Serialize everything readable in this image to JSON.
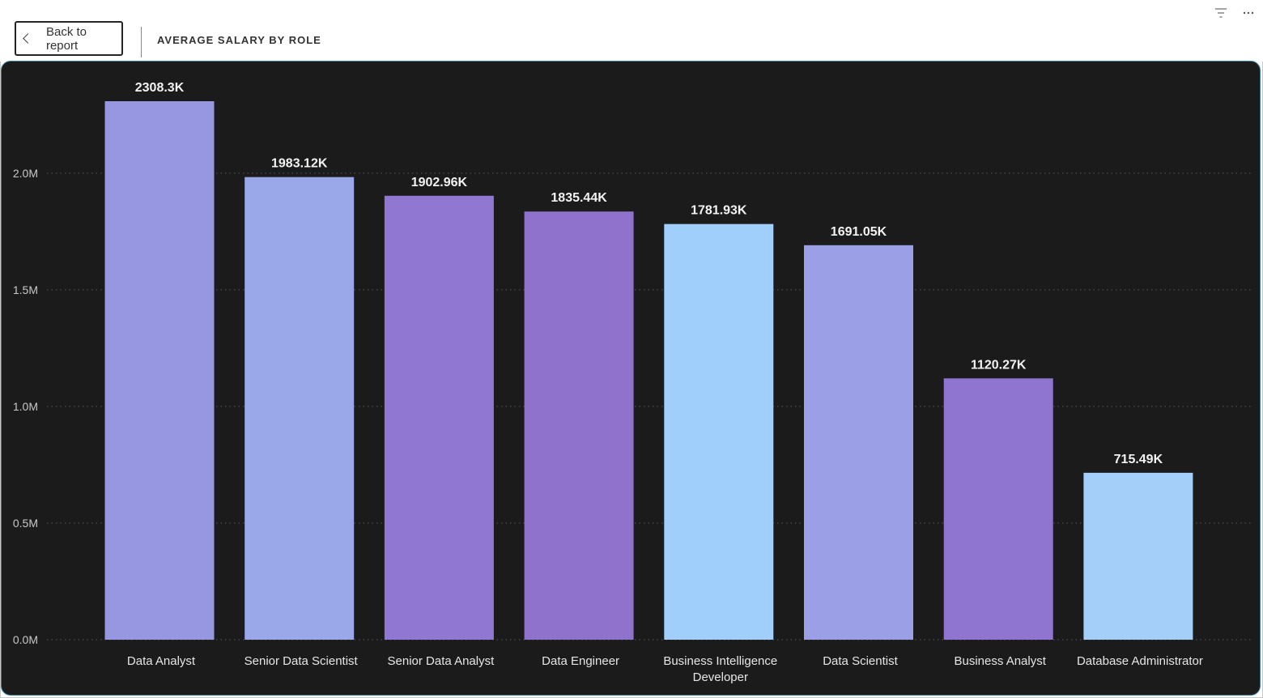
{
  "header": {
    "back_label": "Back to report",
    "title": "AVERAGE SALARY BY ROLE"
  },
  "icons": {
    "back": "chevron-left-icon",
    "filter": "filter-icon",
    "more": "more-options-icon"
  },
  "chart_data": {
    "type": "bar",
    "title": "AVERAGE SALARY BY ROLE",
    "xlabel": "",
    "ylabel": "",
    "categories": [
      [
        "Data Analyst"
      ],
      [
        "Senior Data Scientist"
      ],
      [
        "Senior Data Analyst"
      ],
      [
        "Data Engineer"
      ],
      [
        "Business Intelligence",
        "Developer"
      ],
      [
        "Data Scientist"
      ],
      [
        "Business Analyst"
      ],
      [
        "Database Administrator"
      ]
    ],
    "values": [
      2308300,
      1983120,
      1902960,
      1835440,
      1781930,
      1691050,
      1120270,
      715490
    ],
    "value_labels": [
      "2308.3K",
      "1983.12K",
      "1902.96K",
      "1835.44K",
      "1781.93K",
      "1691.05K",
      "1120.27K",
      "715.49K"
    ],
    "bar_colors": [
      "#9697e0",
      "#9aa8ea",
      "#9077d2",
      "#8f72cc",
      "#a1cffc",
      "#9a9fe6",
      "#8f74d0",
      "#a3cff8"
    ],
    "y_ticks": [
      0,
      500000,
      1000000,
      1500000,
      2000000
    ],
    "y_tick_labels": [
      "0.0M",
      "0.5M",
      "1.0M",
      "1.5M",
      "2.0M"
    ],
    "ylim": [
      0,
      2308300
    ],
    "grid": true,
    "legend": "none",
    "background": "#1b1b1b"
  }
}
